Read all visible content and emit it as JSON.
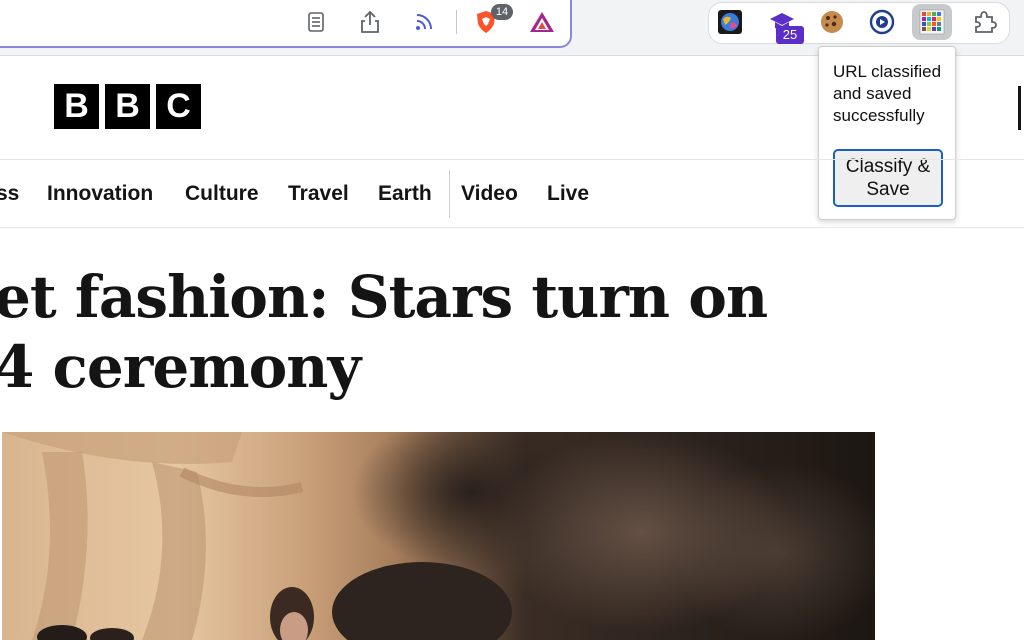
{
  "browser": {
    "brave_shields_count": "14",
    "ext_badge_count": "25"
  },
  "popup": {
    "message": "URL classified and saved successfully",
    "button_label": "Classify & Save"
  },
  "bbc": {
    "logo_letters": [
      "B",
      "B",
      "C"
    ],
    "nav": [
      "ss",
      "Innovation",
      "Culture",
      "Travel",
      "Earth",
      "Video",
      "Live"
    ],
    "headline_line1": "et fashion: Stars turn on",
    "headline_line2": "4 ceremony"
  },
  "colors": {
    "omnibox_focus": "#8b87d9",
    "popup_button_border": "#1a5fc8",
    "badge_purple": "#5b2ec7",
    "brave_orange": "#fb542b"
  }
}
